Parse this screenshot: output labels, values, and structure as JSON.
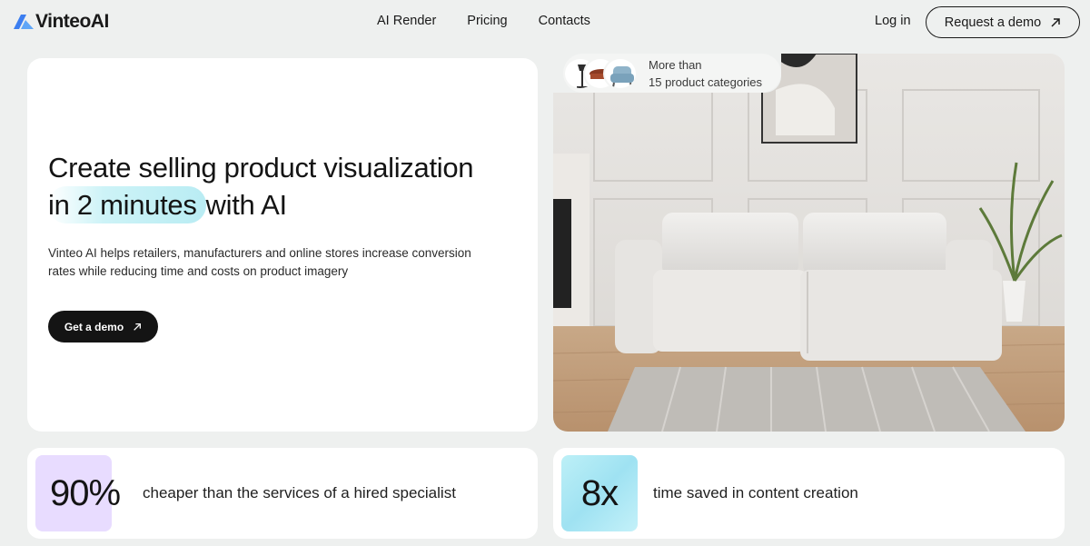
{
  "brand": {
    "name": "VinteoAI",
    "accent": "#4a8cf0"
  },
  "nav": {
    "items": [
      "AI Render",
      "Pricing",
      "Contacts"
    ]
  },
  "header": {
    "login_label": "Log in",
    "demo_label": "Request a demo"
  },
  "hero": {
    "title_line1": "Create selling product visualization",
    "title_highlight": "in 2 minutes",
    "title_rest": "with AI",
    "description_line1": "Vinteo AI helps retailers, manufacturers and online stores increase conversion",
    "description_line2": "rates while reducing time and costs on product imagery",
    "cta_label": "Get a demo"
  },
  "categories": {
    "line1": "More than",
    "line2": "15 product categories"
  },
  "stats": [
    {
      "value": "90%",
      "text": "cheaper than the services of a hired specialist",
      "color": "#e8dcff"
    },
    {
      "value": "8x",
      "text": "time saved in content creation",
      "color": "#b3ecf5"
    }
  ],
  "colors": {
    "background": "#eef0ef",
    "card": "#ffffff",
    "primary": "#141414"
  }
}
